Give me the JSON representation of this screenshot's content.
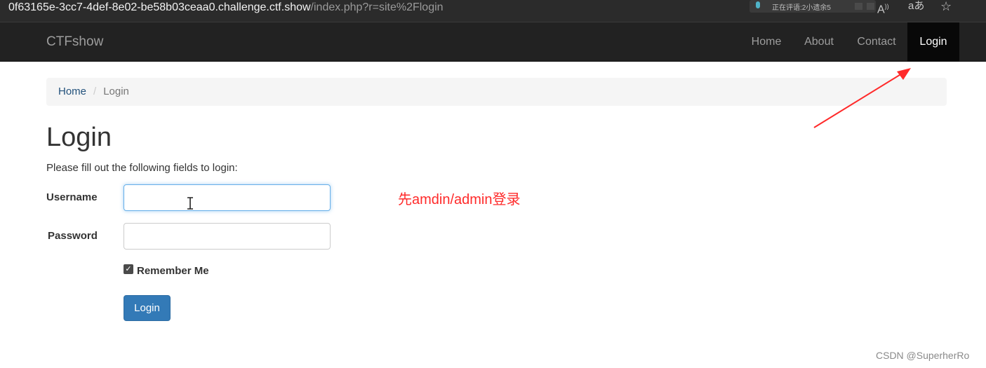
{
  "browser": {
    "url_host": "0f63165e-3cc7-4def-8e02-be58b03ceaa0.challenge.ctf.show",
    "url_path": "/index.php?r=site%2Flogin",
    "extension_text": "正在评语:2小遗余5"
  },
  "navbar": {
    "brand": "CTFshow",
    "items": [
      {
        "label": "Home"
      },
      {
        "label": "About"
      },
      {
        "label": "Contact"
      },
      {
        "label": "Login",
        "active": true
      }
    ]
  },
  "breadcrumb": {
    "home": "Home",
    "separator": "/",
    "current": "Login"
  },
  "form": {
    "title": "Login",
    "intro": "Please fill out the following fields to login:",
    "username_label": "Username",
    "username_value": "",
    "password_label": "Password",
    "password_value": "",
    "remember_label": "Remember Me",
    "remember_checked": true,
    "submit_label": "Login"
  },
  "annotation": {
    "text": "先amdin/admin登录",
    "color": "#ff2a2a"
  },
  "watermark": "CSDN @SuperherRo",
  "colors": {
    "navbar_bg": "#222222",
    "active_nav_bg": "#080808",
    "primary": "#337ab7",
    "link": "#23527c"
  }
}
